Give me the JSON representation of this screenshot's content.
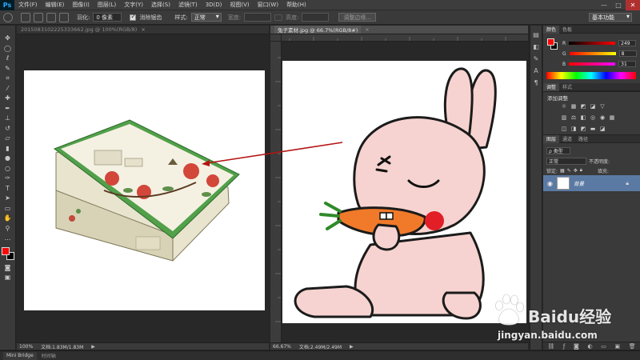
{
  "app": {
    "logo": "Ps"
  },
  "menu": [
    "文件(F)",
    "编辑(E)",
    "图像(I)",
    "图层(L)",
    "文字(Y)",
    "选择(S)",
    "滤镜(T)",
    "3D(D)",
    "视图(V)",
    "窗口(W)",
    "帮助(H)"
  ],
  "window_controls": {
    "minimize": "—",
    "maximize": "□",
    "close": "✕"
  },
  "options": {
    "feather_label": "羽化:",
    "feather_value": "0 像素",
    "antialias_label": "消除锯齿",
    "style_label": "样式:",
    "style_value": "正常",
    "width_label": "宽度:",
    "height_label": "高度:",
    "refine_edge": "调整边缘...",
    "workspace": "基本功能"
  },
  "tools": [
    "move-tool",
    "marquee-tool",
    "lasso-tool",
    "quick-select-tool",
    "crop-tool",
    "eyedropper-tool",
    "healing-tool",
    "brush-tool",
    "stamp-tool",
    "history-brush-tool",
    "eraser-tool",
    "gradient-tool",
    "blur-tool",
    "dodge-tool",
    "pen-tool",
    "type-tool",
    "path-select-tool",
    "shape-tool",
    "hand-tool",
    "zoom-tool"
  ],
  "colors": {
    "foreground": "#f90808",
    "background": "#000000",
    "arrow": "#b41414",
    "layer_selected": "#5b7aa3"
  },
  "doc_left": {
    "tab_title": "20150831022253336​62.jpg @ 100%(RGB/8)",
    "zoom": "100%",
    "doc_info": "文档:1.83M/1.83M"
  },
  "doc_right": {
    "tab_title": "兔子素材.jpg @ 66.7%(RGB/8#)",
    "zoom": "66.67%",
    "doc_info": "文档:2.49M/2.49M"
  },
  "color_panel": {
    "tabs": [
      "颜色",
      "色板"
    ],
    "r_label": "R",
    "g_label": "G",
    "b_label": "B",
    "r_value": "249",
    "g_value": "8",
    "b_value": "31"
  },
  "adjust_panel": {
    "tabs": [
      "调整",
      "样式"
    ],
    "title": "添加调整"
  },
  "layers_panel": {
    "tabs": [
      "图层",
      "通道",
      "路径"
    ],
    "filter_label": "ρ 类型",
    "blend_mode": "正常",
    "opacity_label": "不透明度:",
    "lock_label": "锁定:",
    "fill_label": "填充:",
    "layer_name": "背景"
  },
  "bottom_tabs": [
    "Mini Bridge",
    "时间轴"
  ],
  "watermark": {
    "brand": "Baidu经验",
    "url": "jingyan.baidu.com"
  }
}
